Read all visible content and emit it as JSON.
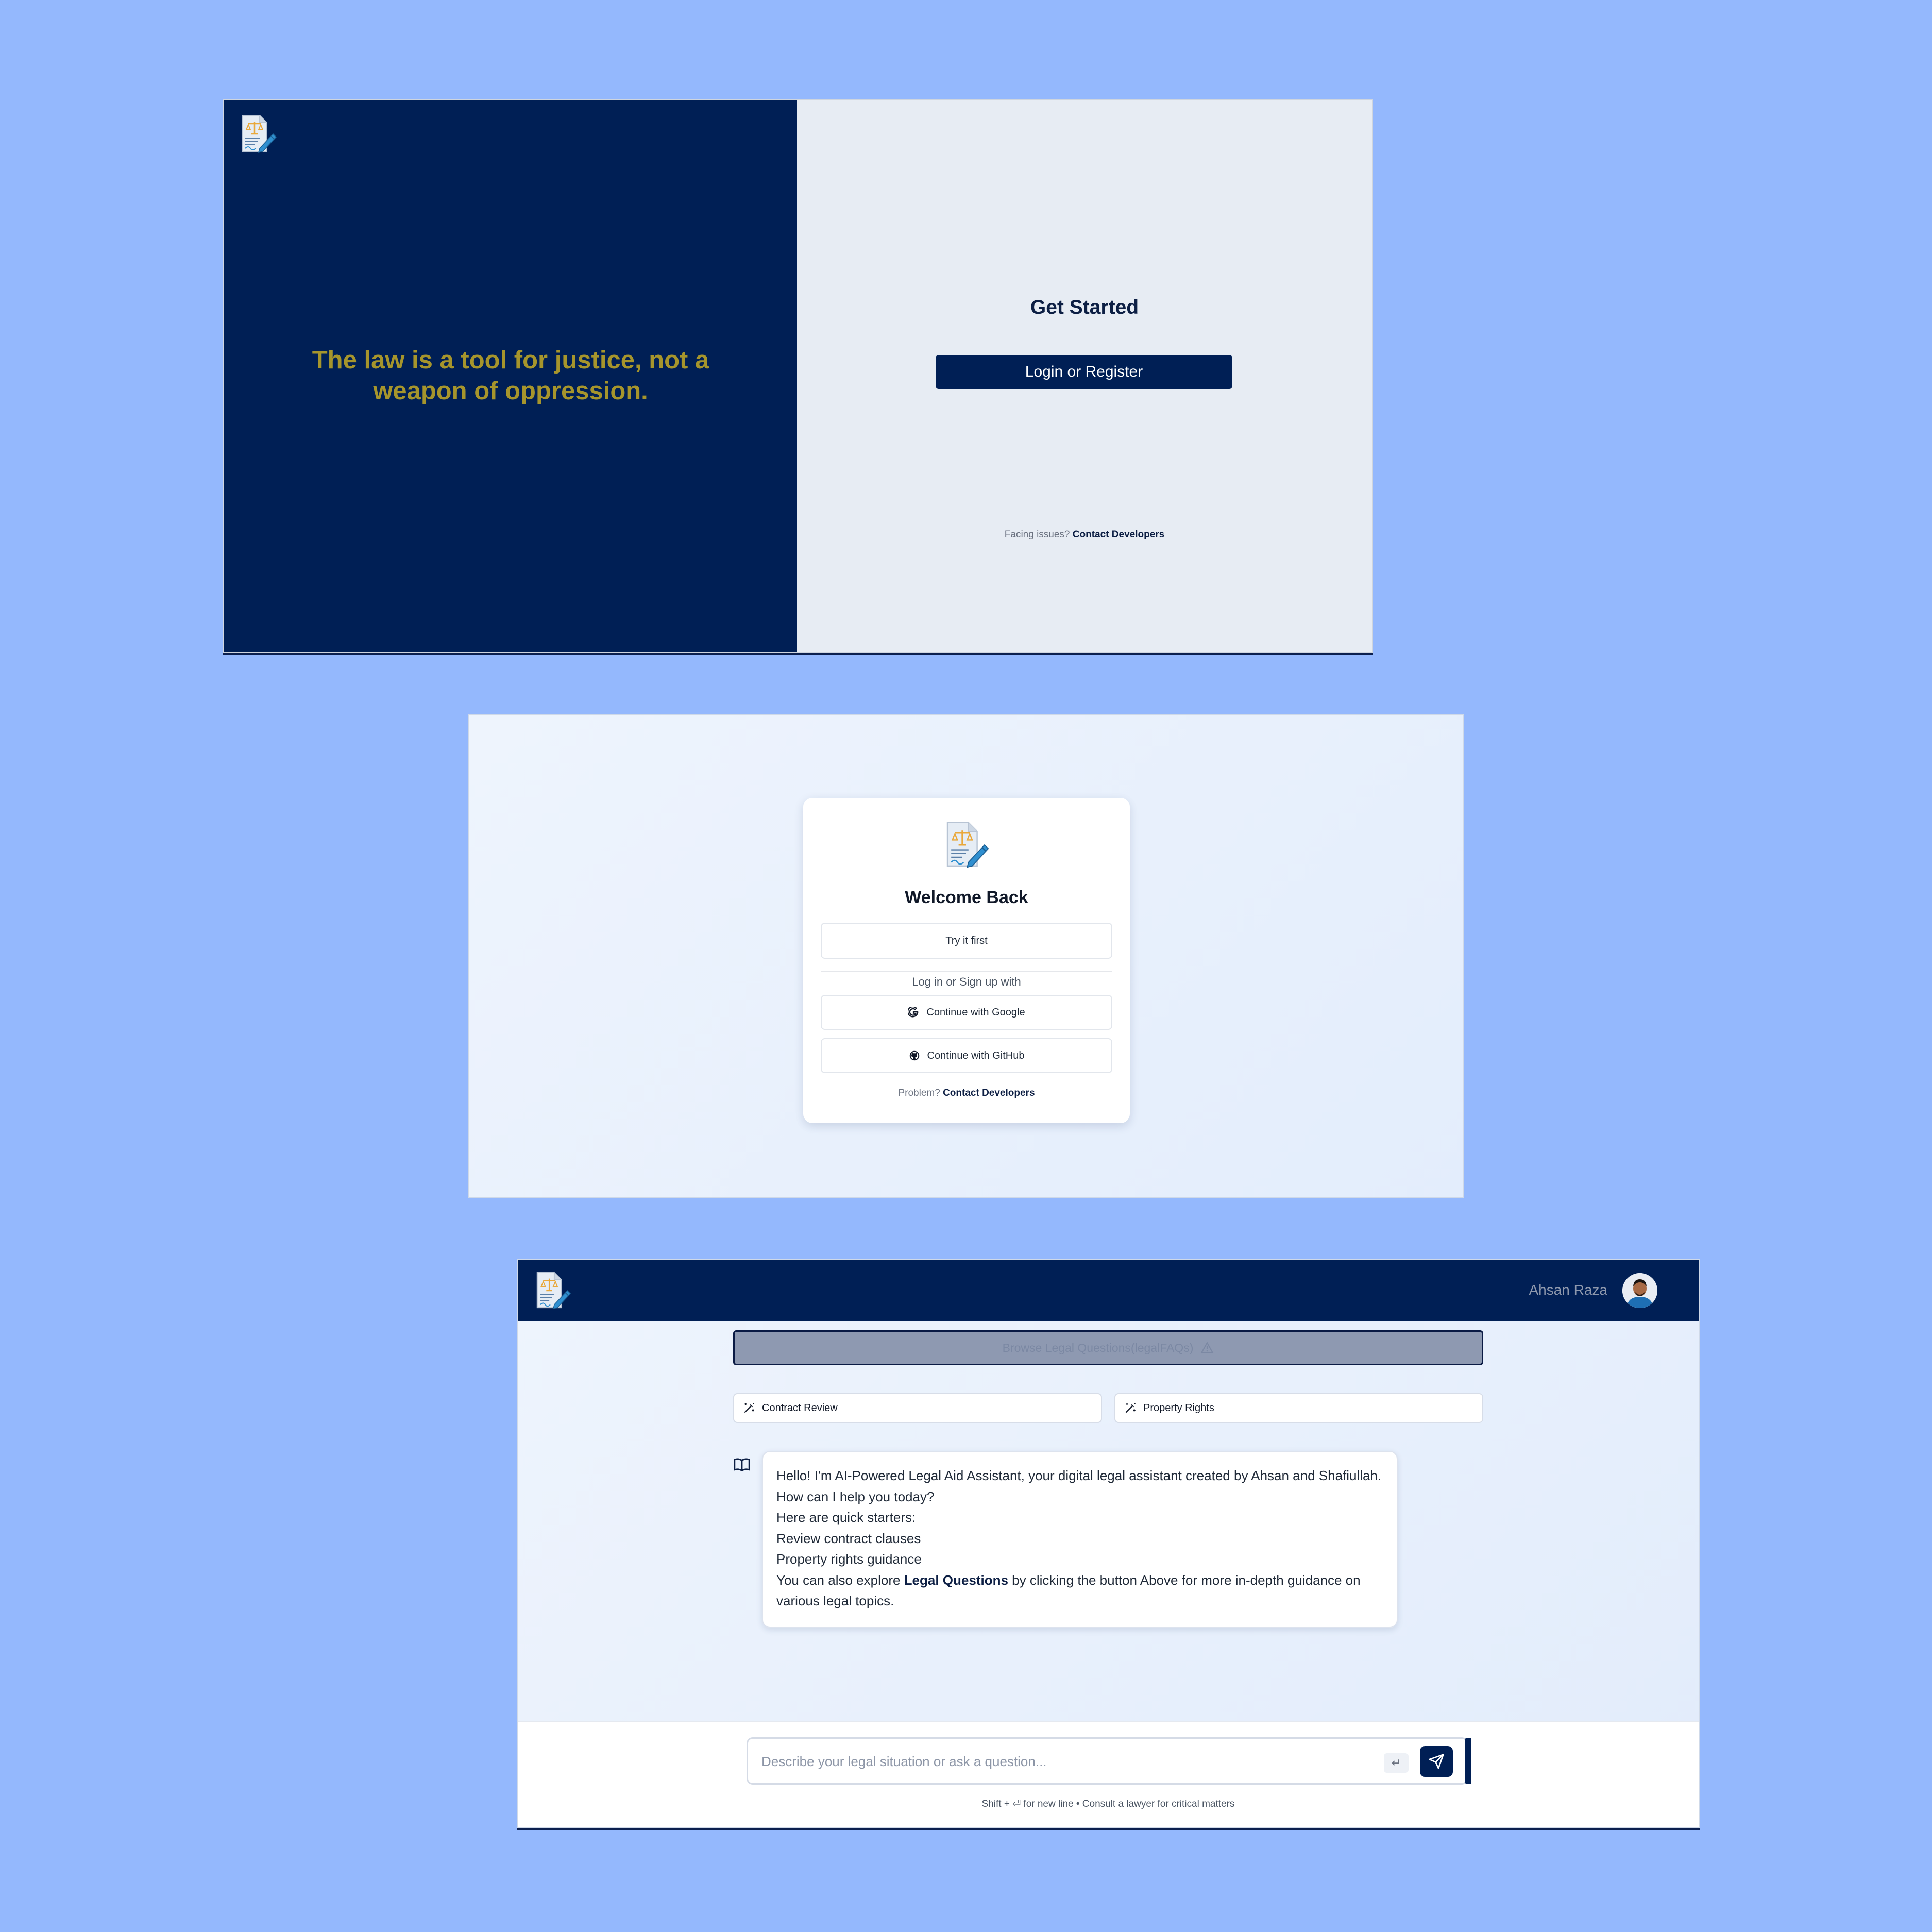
{
  "landing": {
    "quote": "The law is a tool for justice, not a weapon of oppression.",
    "title": "Get Started",
    "login_button": "Login or Register",
    "help_prefix": "Facing issues?",
    "help_link": "Contact Developers"
  },
  "login_card": {
    "title": "Welcome Back",
    "try_button": "Try it first",
    "divider_label": "Log in or Sign up with",
    "google_button": "Continue with Google",
    "github_button": "Continue with GitHub",
    "help_prefix": "Problem?",
    "help_link": "Contact Developers"
  },
  "chat": {
    "user_name": "Ahsan Raza",
    "faq_button": "Browse Legal Questions(legalFAQs)",
    "chips": [
      "Contract Review",
      "Property Rights"
    ],
    "message": {
      "line1": "Hello! I'm AI-Powered Legal Aid Assistant, your digital legal assistant created by Ahsan and Shafiullah. How can I help you today?",
      "line2": "Here are quick starters:",
      "line3": "Review contract clauses",
      "line4": "Property rights guidance",
      "line5_pre": "You can also explore ",
      "line5_bold": "Legal Questions",
      "line5_post": " by clicking the button Above for more in-depth guidance on various legal topics."
    },
    "input_placeholder": "Describe your legal situation or ask a question...",
    "enter_key": "↵",
    "hint": "Shift + ⏎ for new line • Consult a lawyer for critical matters"
  },
  "colors": {
    "navy": "#001f55",
    "gold": "#a6952c",
    "background": "#94b8fd"
  },
  "icons": [
    "app-logo-icon",
    "google-icon",
    "github-icon",
    "magic-wand-icon",
    "book-icon",
    "warning-icon",
    "send-icon"
  ]
}
